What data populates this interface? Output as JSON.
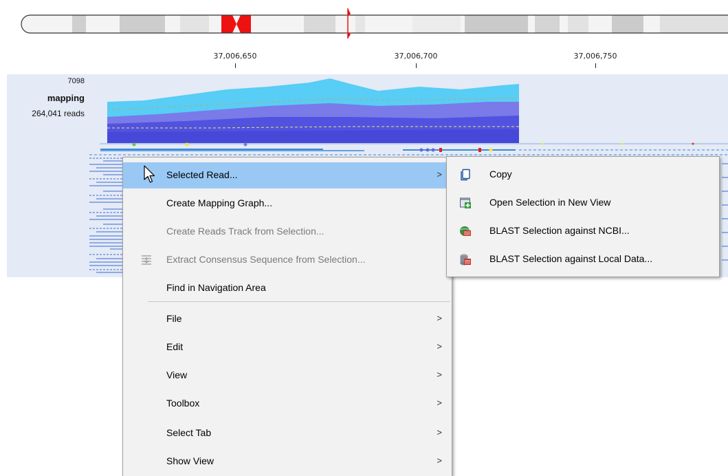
{
  "ruler": {
    "ticks": [
      "37,006,650",
      "37,006,700",
      "37,006,750"
    ]
  },
  "track": {
    "max_coverage": "7098",
    "name": "mapping",
    "reads": "264,041 reads"
  },
  "context_menu": {
    "items": [
      {
        "label": "Selected Read...",
        "has_submenu": true,
        "highlighted": true,
        "enabled": true
      },
      {
        "label": "Create Mapping Graph...",
        "has_submenu": false,
        "enabled": true
      },
      {
        "label": "Create Reads Track from Selection...",
        "has_submenu": false,
        "enabled": false
      },
      {
        "label": "Extract Consensus Sequence from Selection...",
        "has_submenu": false,
        "enabled": false,
        "icon": "extract-consensus-icon"
      },
      {
        "label": "Find in Navigation Area",
        "has_submenu": false,
        "enabled": true
      },
      {
        "label": "File",
        "has_submenu": true,
        "enabled": true
      },
      {
        "label": "Edit",
        "has_submenu": true,
        "enabled": true
      },
      {
        "label": "View",
        "has_submenu": true,
        "enabled": true
      },
      {
        "label": "Toolbox",
        "has_submenu": true,
        "enabled": true
      },
      {
        "label": "Select Tab",
        "has_submenu": true,
        "enabled": true
      },
      {
        "label": "Show View",
        "has_submenu": true,
        "enabled": true
      }
    ],
    "submenu_arrow": ">"
  },
  "submenu": {
    "items": [
      {
        "label": "Copy",
        "icon": "copy-icon"
      },
      {
        "label": "Open Selection in New View",
        "icon": "new-view-icon"
      },
      {
        "label": "BLAST Selection against NCBI...",
        "icon": "blast-ncbi-icon"
      },
      {
        "label": "BLAST Selection against Local Data...",
        "icon": "blast-local-icon"
      }
    ]
  },
  "colors": {
    "menu_highlight": "#99c8f5",
    "track_background": "#e4eaf6",
    "coverage_top": "#58cdf5",
    "coverage_bottom": "#5252e0",
    "centromere": "#ee1111"
  }
}
